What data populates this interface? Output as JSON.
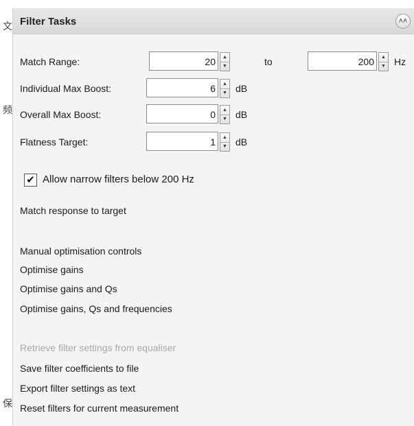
{
  "side_chars": [
    "文",
    "频",
    "保"
  ],
  "panel": {
    "title": "Filter Tasks",
    "collapse_icon": "double-chevron-up-icon"
  },
  "fields": {
    "match_range": {
      "label": "Match Range:",
      "value": "20",
      "to_label": "to",
      "to_value": "200",
      "unit": "Hz"
    },
    "individual_max_boost": {
      "label": "Individual Max Boost:",
      "value": "6",
      "unit": "dB"
    },
    "overall_max_boost": {
      "label": "Overall Max Boost:",
      "value": "0",
      "unit": "dB"
    },
    "flatness_target": {
      "label": "Flatness Target:",
      "value": "1",
      "unit": "dB"
    }
  },
  "spin_glyphs": {
    "up": "▲",
    "down": "▼"
  },
  "allow_narrow": {
    "label": "Allow narrow filters below 200 Hz",
    "checked": true,
    "check_glyph": "✔"
  },
  "actions": {
    "match_response": "Match response to target",
    "manual_controls": "Manual optimisation controls",
    "optimise_gains": "Optimise gains",
    "optimise_gains_qs": "Optimise gains and Qs",
    "optimise_all": "Optimise gains, Qs and frequencies",
    "retrieve": "Retrieve filter settings from equaliser",
    "save_coeffs": "Save filter coefficients to file",
    "export_text": "Export filter settings as text",
    "reset_filters": "Reset filters for current measurement"
  },
  "collapse_glyph": "˄˄"
}
